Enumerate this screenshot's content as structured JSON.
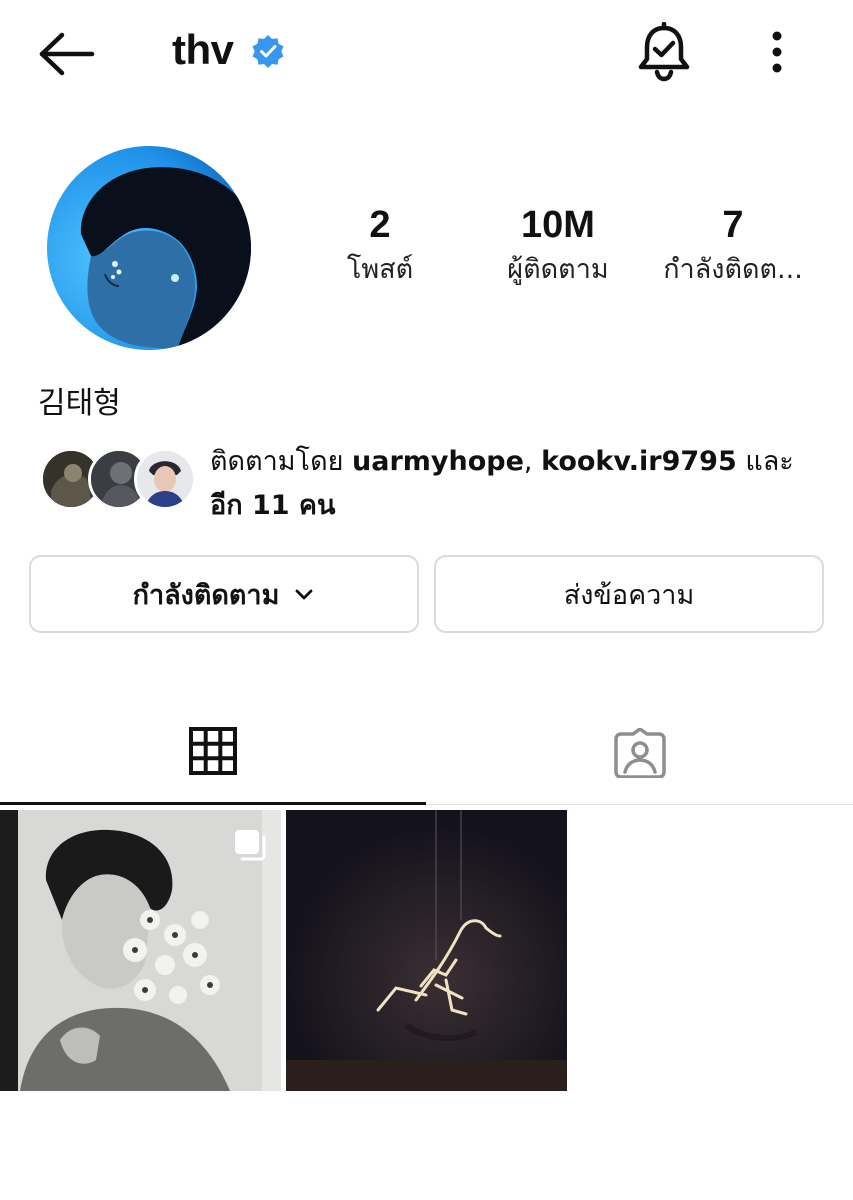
{
  "header": {
    "username": "thv"
  },
  "stats": {
    "posts_count": "2",
    "posts_label": "โพสต์",
    "followers_count": "10M",
    "followers_label": "ผู้ติดตาม",
    "following_count": "7",
    "following_label": "กำลังติดต..."
  },
  "profile": {
    "full_name": "김태형"
  },
  "mutual": {
    "prefix": "ติดตามโดย ",
    "user1": "uarmyhope",
    "separator": ", ",
    "user2": "kookv.ir9795",
    "conjunction": " และ",
    "others": "อีก 11 คน"
  },
  "actions": {
    "following_button": "กำลังติดตาม",
    "message_button": "ส่งข้อความ"
  },
  "colors": {
    "verified_blue": "#3797f0",
    "border": "#dbdbdb"
  },
  "icons": {
    "back": "arrow-left-icon",
    "verified": "verified-badge-icon",
    "notifications": "bell-check-icon",
    "more": "more-vertical-icon",
    "grid": "grid-icon",
    "tagged": "tagged-person-icon",
    "multi": "multiple-images-icon"
  }
}
